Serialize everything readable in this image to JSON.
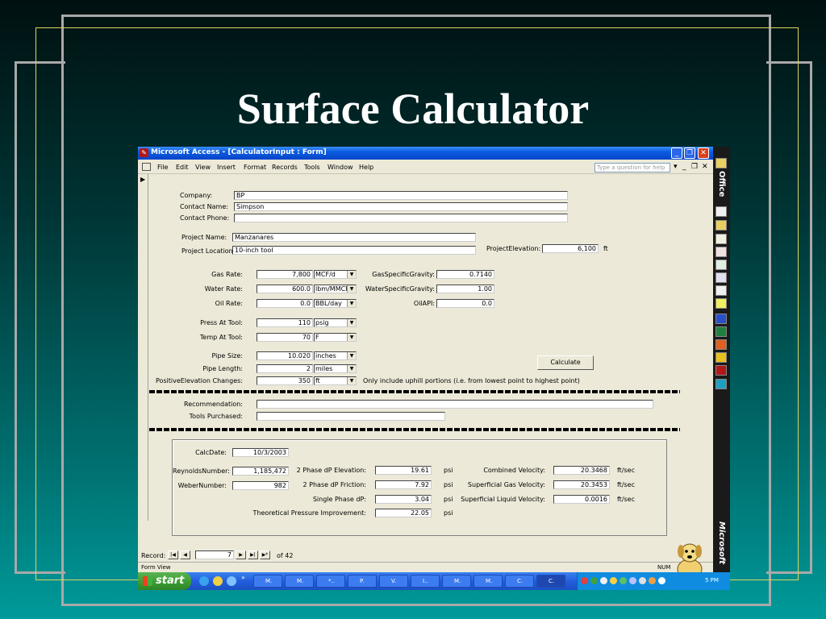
{
  "slide": {
    "title": "Surface Calculator"
  },
  "window": {
    "title": "Microsoft Access - [CalculatorInput : Form]",
    "menu": [
      "File",
      "Edit",
      "View",
      "Insert",
      "Format",
      "Records",
      "Tools",
      "Window",
      "Help"
    ],
    "help_placeholder": "Type a question for help",
    "office_label": "Office",
    "microsoft_label": "Microsoft"
  },
  "form": {
    "company": {
      "label": "Company:",
      "value": "BP"
    },
    "contact_name": {
      "label": "Contact Name:",
      "value": "Simpson"
    },
    "contact_phone": {
      "label": "Contact Phone:",
      "value": ""
    },
    "project_name": {
      "label": "Project Name:",
      "value": "Manzanares"
    },
    "project_location": {
      "label": "Project Location:",
      "value": "10-inch tool"
    },
    "project_elevation": {
      "label": "ProjectElevation:",
      "value": "6,100",
      "unit": "ft"
    },
    "gas_rate": {
      "label": "Gas Rate:",
      "value": "7,800",
      "unit": "MCF/d"
    },
    "water_rate": {
      "label": "Water Rate:",
      "value": "600.0",
      "unit": "lbm/MMCF"
    },
    "oil_rate": {
      "label": "Oil Rate:",
      "value": "0.0",
      "unit": "BBL/day"
    },
    "gas_sg": {
      "label": "GasSpecificGravity:",
      "value": "0.7140"
    },
    "water_sg": {
      "label": "WaterSpecificGravity:",
      "value": "1.00"
    },
    "oil_api": {
      "label": "OilAPI:",
      "value": "0.0"
    },
    "press_at_tool": {
      "label": "Press At Tool:",
      "value": "110",
      "unit": "psig"
    },
    "temp_at_tool": {
      "label": "Temp At Tool:",
      "value": "70",
      "unit": "F"
    },
    "pipe_size": {
      "label": "Pipe Size:",
      "value": "10.020",
      "unit": "inches"
    },
    "pipe_length": {
      "label": "Pipe Length:",
      "value": "2",
      "unit": "miles"
    },
    "positive_elev": {
      "label": "PositiveElevation Changes:",
      "value": "350",
      "unit": "ft",
      "note": "Only include uphill portions (i.e. from lowest point to highest point)"
    },
    "calculate_label": "Calculate",
    "recommendation": {
      "label": "Recommendation:",
      "value": ""
    },
    "tools_purchased": {
      "label": "Tools Purchased:",
      "value": ""
    }
  },
  "results": {
    "calc_date": {
      "label": "CalcDate:",
      "value": "10/3/2003"
    },
    "reynolds": {
      "label": "ReynoldsNumber:",
      "value": "1,185,472"
    },
    "weber": {
      "label": "WeberNumber:",
      "value": "982"
    },
    "two_phase_elev": {
      "label": "2 Phase dP Elevation:",
      "value": "19.61",
      "unit": "psi"
    },
    "two_phase_fric": {
      "label": "2 Phase dP Friction:",
      "value": "7.92",
      "unit": "psi"
    },
    "single_phase": {
      "label": "Single Phase dP:",
      "value": "3.04",
      "unit": "psi"
    },
    "theoretical": {
      "label": "Theoretical Pressure Improvement:",
      "value": "22.05",
      "unit": "psi"
    },
    "combined_vel": {
      "label": "Combined Velocity:",
      "value": "20.3468",
      "unit": "ft/sec"
    },
    "sup_gas_vel": {
      "label": "Superficial Gas Velocity:",
      "value": "20.3453",
      "unit": "ft/sec"
    },
    "sup_liq_vel": {
      "label": "Superficial Liquid Velocity:",
      "value": "0.0016",
      "unit": "ft/sec"
    }
  },
  "navigation": {
    "record_label": "Record:",
    "current": "7",
    "of_label": "of 42"
  },
  "status": {
    "left": "Form View",
    "right": "NUM"
  },
  "taskbar": {
    "start_label": "start",
    "tasks": [
      "M.",
      "M.",
      "*..",
      "P.",
      "V.",
      "I..",
      "M.",
      "M.",
      "C.",
      "C."
    ],
    "clock": "5 PM"
  },
  "colors": {
    "accent": "#0a5ce0",
    "taskbar": "#245edb",
    "start": "#3a9a32"
  }
}
